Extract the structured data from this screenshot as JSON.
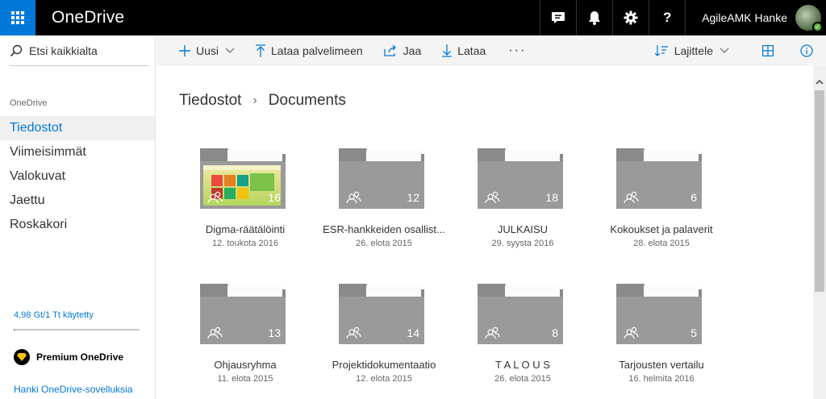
{
  "app": {
    "name": "OneDrive"
  },
  "topbar": {
    "user_name": "AgileAMK Hanke",
    "icons": [
      "chat-icon",
      "bell-icon",
      "gear-icon",
      "help-icon"
    ],
    "help_glyph": "?"
  },
  "search": {
    "placeholder": "Etsi kaikkialta"
  },
  "nav": {
    "header": "OneDrive",
    "items": [
      {
        "label": "Tiedostot",
        "active": true
      },
      {
        "label": "Viimeisimmät",
        "active": false
      },
      {
        "label": "Valokuvat",
        "active": false
      },
      {
        "label": "Jaettu",
        "active": false
      },
      {
        "label": "Roskakori",
        "active": false
      }
    ]
  },
  "storage": {
    "text": "4,98 Gt/1 Tt käytetty",
    "used_fraction": 0.005
  },
  "premium": {
    "label": "Premium OneDrive"
  },
  "get_apps": {
    "label": "Hanki OneDrive-sovelluksia"
  },
  "commands": {
    "new": "Uusi",
    "upload": "Lataa palvelimeen",
    "share": "Jaa",
    "download": "Lataa",
    "more": "···",
    "sort": "Lajittele"
  },
  "breadcrumb": {
    "root": "Tiedostot",
    "current": "Documents",
    "separator": "›"
  },
  "folders": [
    {
      "name": "Digma-räätälöinti",
      "date": "12. toukota 2016",
      "count": "16",
      "has_thumbnail": true
    },
    {
      "name": "ESR-hankkeiden osallist...",
      "date": "26. elota 2015",
      "count": "12",
      "has_thumbnail": false
    },
    {
      "name": "JULKAISU",
      "date": "29. syysta 2016",
      "count": "18",
      "has_thumbnail": false
    },
    {
      "name": "Kokoukset ja palaverit",
      "date": "28. elota 2015",
      "count": "6",
      "has_thumbnail": false
    },
    {
      "name": "Ohjausryhma",
      "date": "11. elota 2015",
      "count": "13",
      "has_thumbnail": false
    },
    {
      "name": "Projektidokumentaatio",
      "date": "12. elota 2015",
      "count": "14",
      "has_thumbnail": false
    },
    {
      "name": "T A L O U S",
      "date": "26. elota 2015",
      "count": "8",
      "has_thumbnail": false
    },
    {
      "name": "Tarjousten vertailu",
      "date": "16. helmita 2016",
      "count": "5",
      "has_thumbnail": false
    }
  ],
  "colors": {
    "accent": "#0078d7",
    "topbar": "#000000",
    "folder": "#9a9a9a"
  }
}
